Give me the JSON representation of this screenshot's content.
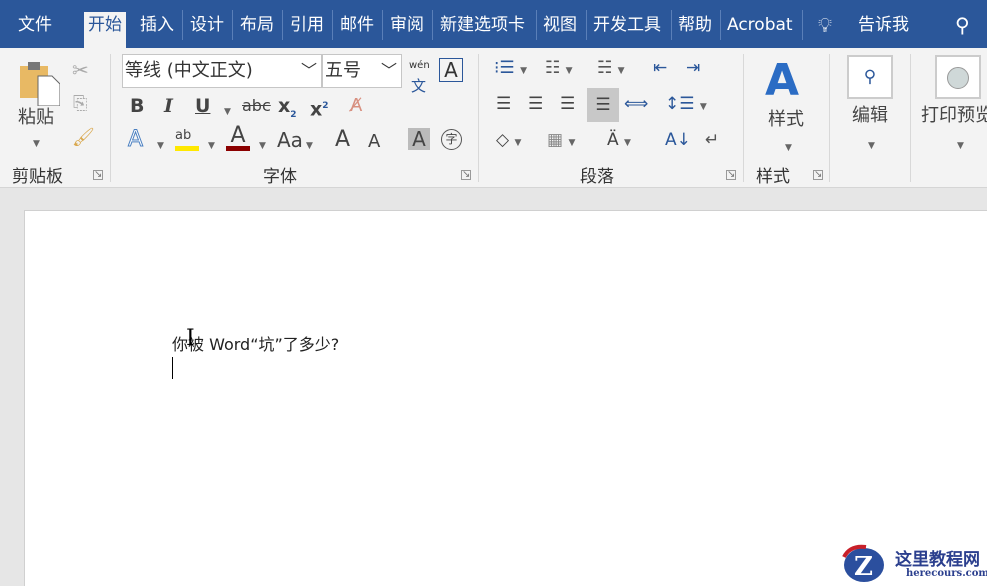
{
  "tabs": [
    "文件",
    "开始",
    "插入",
    "设计",
    "布局",
    "引用",
    "邮件",
    "审阅",
    "新建选项卡",
    "视图",
    "开发工具",
    "帮助",
    "Acrobat"
  ],
  "tell_me": "告诉我",
  "clipboard": {
    "paste": "粘贴",
    "group": "剪贴板"
  },
  "font": {
    "name": "等线 (中文正文)",
    "size": "五号",
    "group": "字体",
    "phonetic_top": "wén",
    "phonetic_bottom": "文",
    "bold": "B",
    "italic": "I",
    "underline": "U",
    "strike": "abc",
    "sub": "x",
    "sub2": "2",
    "sup": "x",
    "sup2": "2",
    "text_effects": "A",
    "highlight": "ab",
    "font_color": "A",
    "change_case": "Aa",
    "grow": "A",
    "shrink": "A",
    "shading": "A",
    "enclose": "字",
    "border_char": "A"
  },
  "paragraph": {
    "group": "段落"
  },
  "styles": {
    "label": "样式",
    "group": "样式"
  },
  "editing": {
    "label": "编辑"
  },
  "print_preview": {
    "label": "打印预览"
  },
  "document": {
    "text": "你被 Word“坑”了多少?"
  },
  "watermark": {
    "name": "这里教程网",
    "url": "herecours.com"
  },
  "colors": {
    "accent": "#2b579a",
    "highlight": "#ffe800",
    "font_color": "#8b0000"
  }
}
